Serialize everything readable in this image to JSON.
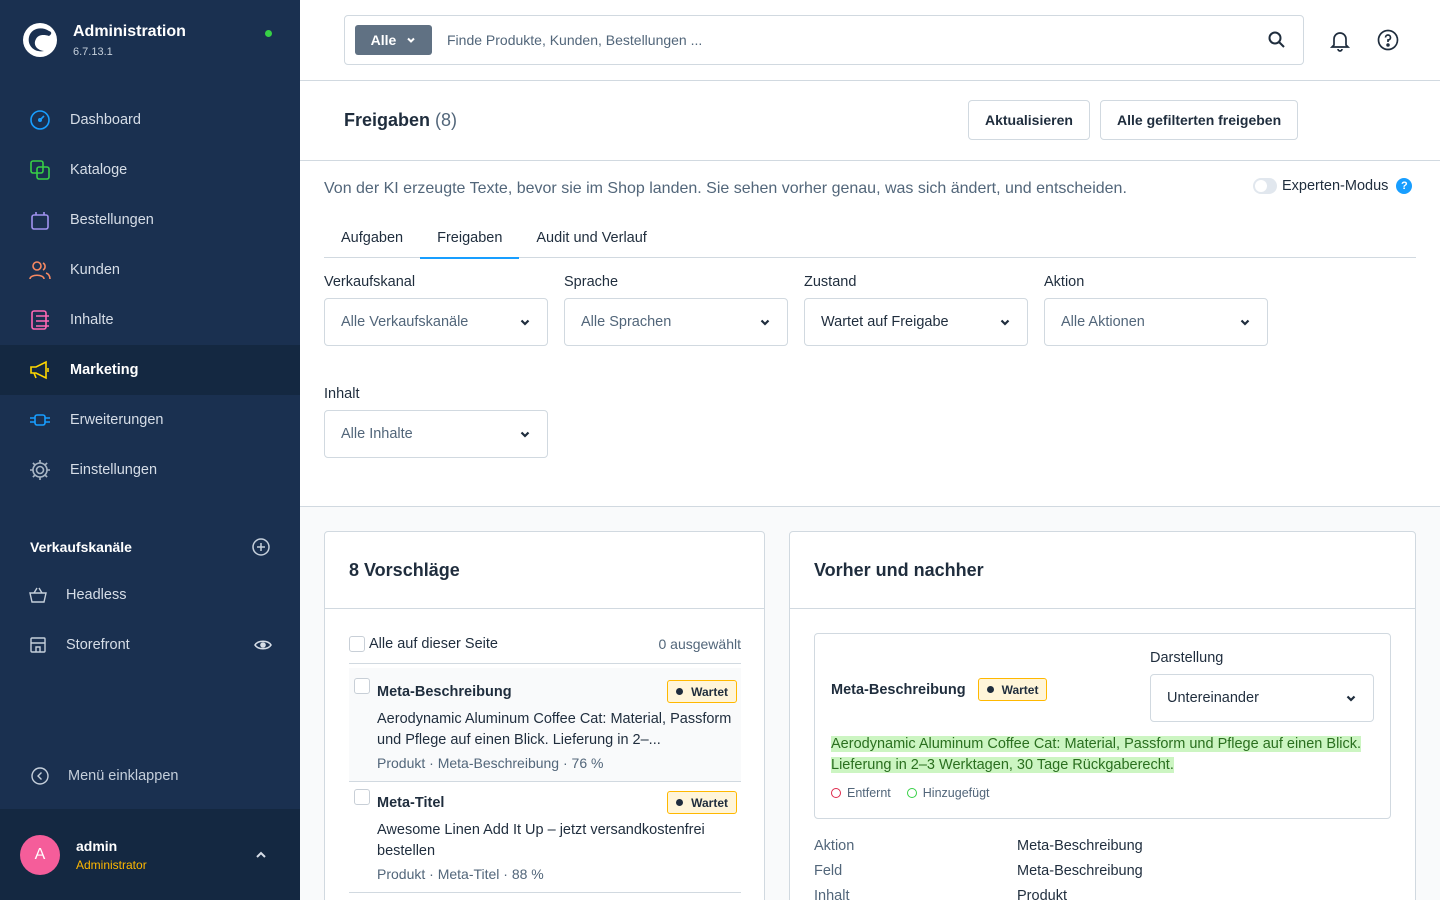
{
  "app": {
    "title": "Administration",
    "version": "6.7.13.1"
  },
  "colors": {
    "sidebar_bg": "#1a3050",
    "active_bg": "#142841",
    "accent": "#189eff",
    "warning": "#ffb800",
    "added": "#37d046",
    "removed": "#de294c"
  },
  "sidebar": {
    "items": [
      {
        "label": "Dashboard",
        "icon": "gauge-icon"
      },
      {
        "label": "Kataloge",
        "icon": "catalog-icon"
      },
      {
        "label": "Bestellungen",
        "icon": "shopping-bag-icon"
      },
      {
        "label": "Kunden",
        "icon": "users-icon"
      },
      {
        "label": "Inhalte",
        "icon": "content-icon"
      },
      {
        "label": "Marketing",
        "icon": "megaphone-icon",
        "active": true
      },
      {
        "label": "Erweiterungen",
        "icon": "plug-icon"
      },
      {
        "label": "Einstellungen",
        "icon": "gear-icon"
      }
    ],
    "sales_channels_title": "Verkaufskanäle",
    "sales_channels": [
      {
        "label": "Headless",
        "icon": "basket-icon"
      },
      {
        "label": "Storefront",
        "icon": "storefront-icon"
      }
    ],
    "collapse_label": "Menü einklappen"
  },
  "user": {
    "initial": "A",
    "name": "admin",
    "role": "Administrator"
  },
  "search": {
    "type_label": "Alle",
    "placeholder": "Finde Produkte, Kunden, Bestellungen ..."
  },
  "page": {
    "title": "Freigaben",
    "count": "(8)",
    "refresh_button": "Aktualisieren",
    "approve_all_button": "Alle gefilterten freigeben",
    "intro": "Von der KI erzeugte Texte, bevor sie im Shop landen. Sie sehen vorher genau, was sich ändert, und entscheiden.",
    "expert_mode_label": "Experten-Modus",
    "expert_mode_on": false,
    "help_glyph": "?"
  },
  "tabs": [
    {
      "label": "Aufgaben"
    },
    {
      "label": "Freigaben",
      "active": true
    },
    {
      "label": "Audit und Verlauf"
    }
  ],
  "filters": {
    "sales_channel": {
      "label": "Verkaufskanal",
      "value": "Alle Verkaufskanäle"
    },
    "language": {
      "label": "Sprache",
      "value": "Alle Sprachen"
    },
    "state": {
      "label": "Zustand",
      "value": "Wartet auf Freigabe"
    },
    "action": {
      "label": "Aktion",
      "value": "Alle Aktionen"
    },
    "content": {
      "label": "Inhalt",
      "value": "Alle Inhalte"
    }
  },
  "suggestions": {
    "title": "8 Vorschläge",
    "select_all_label": "Alle auf dieser Seite",
    "selected_count": "0 ausgewählt",
    "items": [
      {
        "title": "Meta-Beschreibung",
        "status": "Wartet",
        "text": "Aerodynamic Aluminum Coffee Cat: Material, Passform und Pflege auf einen Blick. Lieferung in 2–...",
        "meta": "Produkt · Meta-Beschreibung · 76 %"
      },
      {
        "title": "Meta-Titel",
        "status": "Wartet",
        "text": "Awesome Linen Add It Up – jetzt versandkostenfrei bestellen",
        "meta": "Produkt · Meta-Titel · 88 %"
      }
    ]
  },
  "comparison": {
    "title": "Vorher und nachher",
    "field_title": "Meta-Beschreibung",
    "status": "Wartet",
    "display_label": "Darstellung",
    "display_value": "Untereinander",
    "added_text": "Aerodynamic Aluminum Coffee Cat: Material, Passform und Pflege auf einen Blick. Lieferung in 2–3 Werktagen, 30 Tage Rückgaberecht.",
    "legend_removed": "Entfernt",
    "legend_added": "Hinzugefügt",
    "details": [
      {
        "key": "Aktion",
        "value": "Meta-Beschreibung"
      },
      {
        "key": "Feld",
        "value": "Meta-Beschreibung"
      },
      {
        "key": "Inhalt",
        "value": "Produkt"
      }
    ]
  }
}
